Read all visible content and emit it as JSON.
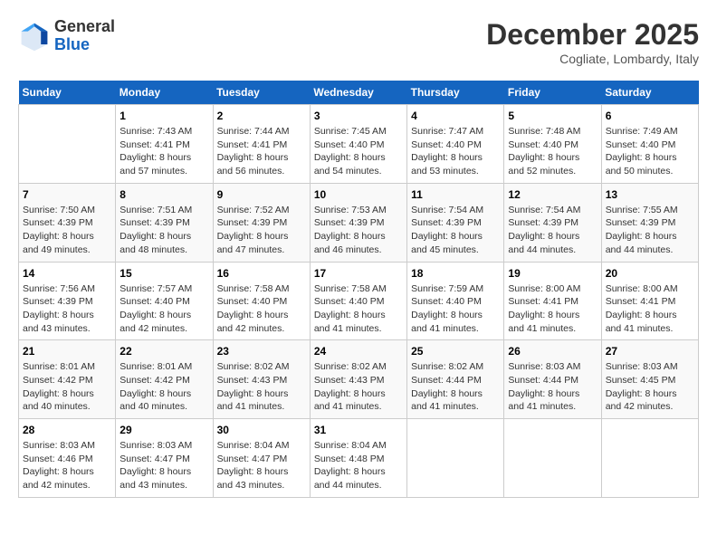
{
  "logo": {
    "line1": "General",
    "line2": "Blue"
  },
  "title": "December 2025",
  "location": "Cogliate, Lombardy, Italy",
  "weekdays": [
    "Sunday",
    "Monday",
    "Tuesday",
    "Wednesday",
    "Thursday",
    "Friday",
    "Saturday"
  ],
  "weeks": [
    [
      {
        "day": "",
        "empty": true
      },
      {
        "day": "1",
        "sunrise": "Sunrise: 7:43 AM",
        "sunset": "Sunset: 4:41 PM",
        "daylight": "Daylight: 8 hours and 57 minutes."
      },
      {
        "day": "2",
        "sunrise": "Sunrise: 7:44 AM",
        "sunset": "Sunset: 4:41 PM",
        "daylight": "Daylight: 8 hours and 56 minutes."
      },
      {
        "day": "3",
        "sunrise": "Sunrise: 7:45 AM",
        "sunset": "Sunset: 4:40 PM",
        "daylight": "Daylight: 8 hours and 54 minutes."
      },
      {
        "day": "4",
        "sunrise": "Sunrise: 7:47 AM",
        "sunset": "Sunset: 4:40 PM",
        "daylight": "Daylight: 8 hours and 53 minutes."
      },
      {
        "day": "5",
        "sunrise": "Sunrise: 7:48 AM",
        "sunset": "Sunset: 4:40 PM",
        "daylight": "Daylight: 8 hours and 52 minutes."
      },
      {
        "day": "6",
        "sunrise": "Sunrise: 7:49 AM",
        "sunset": "Sunset: 4:40 PM",
        "daylight": "Daylight: 8 hours and 50 minutes."
      }
    ],
    [
      {
        "day": "7",
        "sunrise": "Sunrise: 7:50 AM",
        "sunset": "Sunset: 4:39 PM",
        "daylight": "Daylight: 8 hours and 49 minutes."
      },
      {
        "day": "8",
        "sunrise": "Sunrise: 7:51 AM",
        "sunset": "Sunset: 4:39 PM",
        "daylight": "Daylight: 8 hours and 48 minutes."
      },
      {
        "day": "9",
        "sunrise": "Sunrise: 7:52 AM",
        "sunset": "Sunset: 4:39 PM",
        "daylight": "Daylight: 8 hours and 47 minutes."
      },
      {
        "day": "10",
        "sunrise": "Sunrise: 7:53 AM",
        "sunset": "Sunset: 4:39 PM",
        "daylight": "Daylight: 8 hours and 46 minutes."
      },
      {
        "day": "11",
        "sunrise": "Sunrise: 7:54 AM",
        "sunset": "Sunset: 4:39 PM",
        "daylight": "Daylight: 8 hours and 45 minutes."
      },
      {
        "day": "12",
        "sunrise": "Sunrise: 7:54 AM",
        "sunset": "Sunset: 4:39 PM",
        "daylight": "Daylight: 8 hours and 44 minutes."
      },
      {
        "day": "13",
        "sunrise": "Sunrise: 7:55 AM",
        "sunset": "Sunset: 4:39 PM",
        "daylight": "Daylight: 8 hours and 44 minutes."
      }
    ],
    [
      {
        "day": "14",
        "sunrise": "Sunrise: 7:56 AM",
        "sunset": "Sunset: 4:39 PM",
        "daylight": "Daylight: 8 hours and 43 minutes."
      },
      {
        "day": "15",
        "sunrise": "Sunrise: 7:57 AM",
        "sunset": "Sunset: 4:40 PM",
        "daylight": "Daylight: 8 hours and 42 minutes."
      },
      {
        "day": "16",
        "sunrise": "Sunrise: 7:58 AM",
        "sunset": "Sunset: 4:40 PM",
        "daylight": "Daylight: 8 hours and 42 minutes."
      },
      {
        "day": "17",
        "sunrise": "Sunrise: 7:58 AM",
        "sunset": "Sunset: 4:40 PM",
        "daylight": "Daylight: 8 hours and 41 minutes."
      },
      {
        "day": "18",
        "sunrise": "Sunrise: 7:59 AM",
        "sunset": "Sunset: 4:40 PM",
        "daylight": "Daylight: 8 hours and 41 minutes."
      },
      {
        "day": "19",
        "sunrise": "Sunrise: 8:00 AM",
        "sunset": "Sunset: 4:41 PM",
        "daylight": "Daylight: 8 hours and 41 minutes."
      },
      {
        "day": "20",
        "sunrise": "Sunrise: 8:00 AM",
        "sunset": "Sunset: 4:41 PM",
        "daylight": "Daylight: 8 hours and 41 minutes."
      }
    ],
    [
      {
        "day": "21",
        "sunrise": "Sunrise: 8:01 AM",
        "sunset": "Sunset: 4:42 PM",
        "daylight": "Daylight: 8 hours and 40 minutes."
      },
      {
        "day": "22",
        "sunrise": "Sunrise: 8:01 AM",
        "sunset": "Sunset: 4:42 PM",
        "daylight": "Daylight: 8 hours and 40 minutes."
      },
      {
        "day": "23",
        "sunrise": "Sunrise: 8:02 AM",
        "sunset": "Sunset: 4:43 PM",
        "daylight": "Daylight: 8 hours and 41 minutes."
      },
      {
        "day": "24",
        "sunrise": "Sunrise: 8:02 AM",
        "sunset": "Sunset: 4:43 PM",
        "daylight": "Daylight: 8 hours and 41 minutes."
      },
      {
        "day": "25",
        "sunrise": "Sunrise: 8:02 AM",
        "sunset": "Sunset: 4:44 PM",
        "daylight": "Daylight: 8 hours and 41 minutes."
      },
      {
        "day": "26",
        "sunrise": "Sunrise: 8:03 AM",
        "sunset": "Sunset: 4:44 PM",
        "daylight": "Daylight: 8 hours and 41 minutes."
      },
      {
        "day": "27",
        "sunrise": "Sunrise: 8:03 AM",
        "sunset": "Sunset: 4:45 PM",
        "daylight": "Daylight: 8 hours and 42 minutes."
      }
    ],
    [
      {
        "day": "28",
        "sunrise": "Sunrise: 8:03 AM",
        "sunset": "Sunset: 4:46 PM",
        "daylight": "Daylight: 8 hours and 42 minutes."
      },
      {
        "day": "29",
        "sunrise": "Sunrise: 8:03 AM",
        "sunset": "Sunset: 4:47 PM",
        "daylight": "Daylight: 8 hours and 43 minutes."
      },
      {
        "day": "30",
        "sunrise": "Sunrise: 8:04 AM",
        "sunset": "Sunset: 4:47 PM",
        "daylight": "Daylight: 8 hours and 43 minutes."
      },
      {
        "day": "31",
        "sunrise": "Sunrise: 8:04 AM",
        "sunset": "Sunset: 4:48 PM",
        "daylight": "Daylight: 8 hours and 44 minutes."
      },
      {
        "day": "",
        "empty": true
      },
      {
        "day": "",
        "empty": true
      },
      {
        "day": "",
        "empty": true
      }
    ]
  ]
}
